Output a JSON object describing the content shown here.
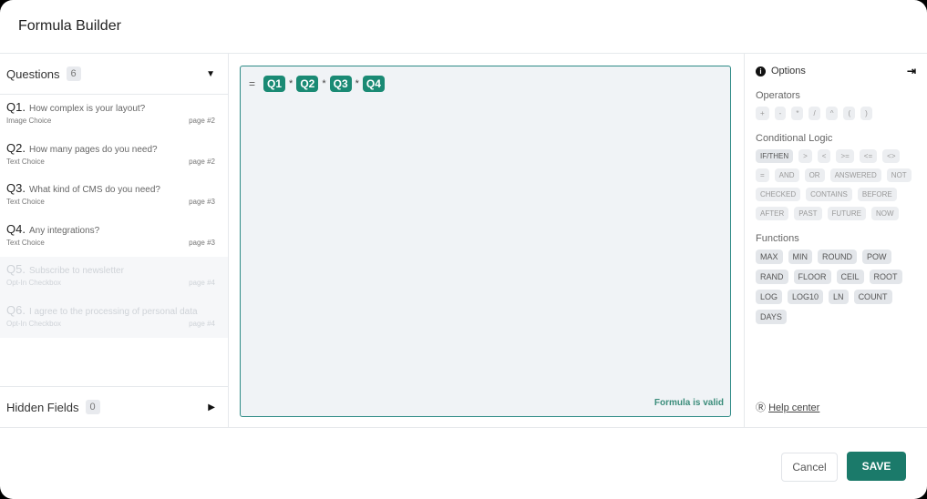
{
  "header": {
    "title": "Formula Builder"
  },
  "questions": {
    "label": "Questions",
    "count": "6",
    "items": [
      {
        "num": "Q1.",
        "text": "How complex is your layout?",
        "type": "Image Choice",
        "page": "page #2",
        "enabled": true
      },
      {
        "num": "Q2.",
        "text": "How many pages do you need?",
        "type": "Text Choice",
        "page": "page #2",
        "enabled": true
      },
      {
        "num": "Q3.",
        "text": "What kind of CMS do you need?",
        "type": "Text Choice",
        "page": "page #3",
        "enabled": true
      },
      {
        "num": "Q4.",
        "text": "Any integrations?",
        "type": "Text Choice",
        "page": "page #3",
        "enabled": true
      },
      {
        "num": "Q5.",
        "text": "Subscribe to newsletter",
        "type": "Opt-In Checkbox",
        "page": "page #4",
        "enabled": false
      },
      {
        "num": "Q6.",
        "text": "I agree to the processing of personal data",
        "type": "Opt-In Checkbox",
        "page": "page #4",
        "enabled": false
      }
    ]
  },
  "hidden_fields": {
    "label": "Hidden Fields",
    "count": "0"
  },
  "formula": {
    "equals": "=",
    "tokens": [
      "Q1",
      "Q2",
      "Q3",
      "Q4"
    ],
    "operator": "*",
    "status": "Formula is valid"
  },
  "options": {
    "title": "Options",
    "operators_label": "Operators",
    "operators": [
      "+",
      "-",
      "*",
      "/",
      "^",
      "(",
      ")"
    ],
    "logic_label": "Conditional Logic",
    "logic": [
      "IF/THEN",
      ">",
      "<",
      ">=",
      "<=",
      "<>",
      "=",
      "AND",
      "OR",
      "ANSWERED",
      "NOT",
      "CHECKED",
      "CONTAINS",
      "BEFORE",
      "AFTER",
      "PAST",
      "FUTURE",
      "NOW"
    ],
    "functions_label": "Functions",
    "functions": [
      "MAX",
      "MIN",
      "ROUND",
      "POW",
      "RAND",
      "FLOOR",
      "CEIL",
      "ROOT",
      "LOG",
      "LOG10",
      "LN",
      "COUNT",
      "DAYS"
    ],
    "help": "Help center"
  },
  "footer": {
    "cancel": "Cancel",
    "save": "SAVE"
  },
  "colors": {
    "accent": "#1b7a6a",
    "token": "#1a8a74",
    "valid": "#3a8c7a"
  }
}
